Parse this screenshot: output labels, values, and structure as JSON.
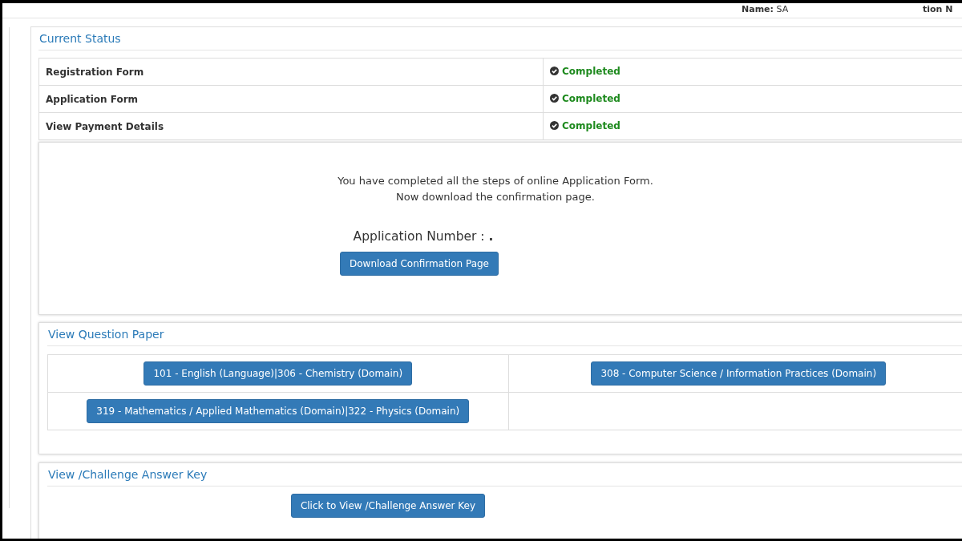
{
  "header": {
    "name_label": "Name:",
    "name_value": "SA",
    "trailing_text": "tion N"
  },
  "current_status": {
    "title": "Current Status",
    "rows": [
      {
        "label": "Registration Form",
        "status": "Completed",
        "completed": true
      },
      {
        "label": "Application Form",
        "status": "Completed",
        "completed": true
      },
      {
        "label": "View Payment Details",
        "status": "Completed",
        "completed": true
      }
    ]
  },
  "confirmation": {
    "message": [
      "You have completed all the steps of online Application Form.",
      "Now download the confirmation page."
    ],
    "number_label": "Application Number :",
    "number_value": ".",
    "button": "Download Confirmation Page"
  },
  "question_paper": {
    "title": "View Question Paper",
    "rows": [
      {
        "cells": [
          {
            "label": "101 - English (Language)|306 - Chemistry (Domain)"
          },
          {
            "label": "308 - Computer Science / Information Practices (Domain)"
          }
        ]
      },
      {
        "cells": [
          {
            "label": "319 - Mathematics / Applied Mathematics (Domain)|322 - Physics (Domain)"
          }
        ]
      }
    ]
  },
  "answer_key": {
    "title": "View /Challenge Answer Key",
    "button": "Click to View /Challenge Answer Key"
  }
}
